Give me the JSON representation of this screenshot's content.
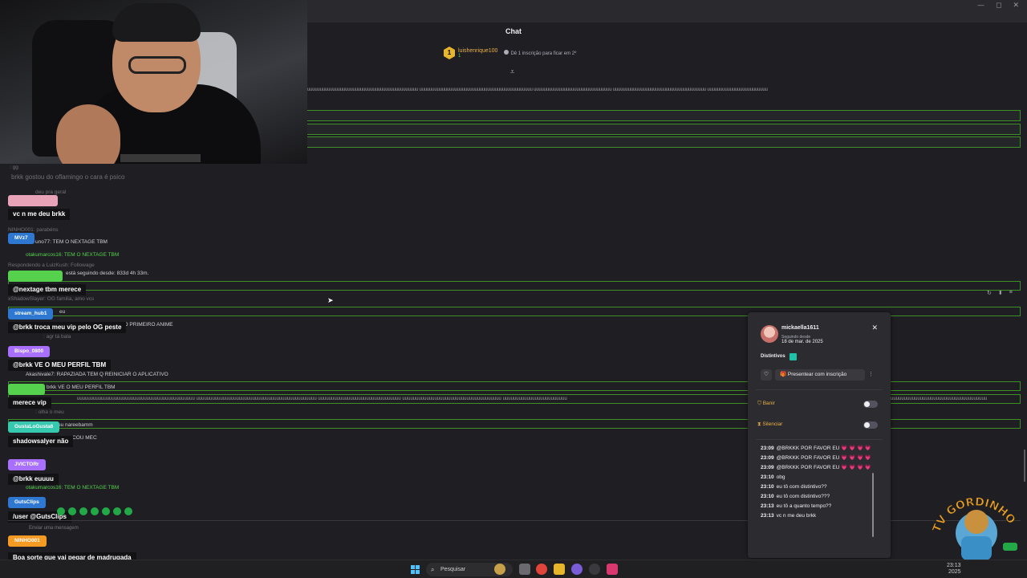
{
  "window": {
    "chat_title": "Chat",
    "minimize": "—",
    "maximize": "◻",
    "close": "✕"
  },
  "hype_train": {
    "rank": "1",
    "username": "luishenrique100",
    "count": "1",
    "gift_text": "Dê 1 inscrição para ficar em 2º"
  },
  "spam_text": "uuuuuuuuuuuuuuuuuuuuuuuuuuuuuuuuuuuuuuuuuuuu uuuuuuuuuuuuuuuuuuuuuuuuuuuuuuuuuuuuuuuuuuuuu uuuuuuuuuuuuuuuuuuuuuuuuuuuuuuu uuuuuuuuuuuuuuuuuuuuuuuuuuuuuuuuuuuuu uuuuuuuuuuuuuuuuuuuuuuuu",
  "background_chat": [
    {
      "text": ": gg"
    },
    {
      "text": "brkk gostou do oflamingo o cara é psico"
    },
    {
      "text": "deu pra geral"
    },
    {
      "text": "NINHO001: parabéns"
    },
    {
      "text": "uno77: TEM O NEXTAGE TBM"
    },
    {
      "text": "otakumarcos16: TEM O NEXTAGE TBM"
    },
    {
      "text": "Respondendo a LuizKush: Followage"
    },
    {
      "text": "está seguindo desde: 833d 4h 33m."
    },
    {
      "text": "xShadowSlayer: OG familia, amo vcs"
    },
    {
      "text": "eu"
    },
    {
      "text": "BRKK TO AO PODER TER O PRIMEIRO ANIME"
    },
    {
      "text": ": agr tá bala"
    },
    {
      "text": "Akashivale7: RAPAZIADA TEM Q REINICIAR O APLICATIVO"
    },
    {
      "text": "brkk VE O MEU PERFIL TBM"
    },
    {
      "text": ": olha o meu"
    },
    {
      "text": "uu nareebamm"
    },
    {
      "text": "COU MEC"
    },
    {
      "text": "otakumarcos16: TEM O NEXTAGE TBM"
    }
  ],
  "overlay_messages": [
    {
      "user": "",
      "color": "#e9a3b8",
      "text": "vc n me deu brkk"
    },
    {
      "user": "MVz7",
      "color": "#2e78d2",
      "text": ""
    },
    {
      "user": "",
      "color": "#56d14d",
      "text": "@nextage tbm merece"
    },
    {
      "user": "stream_hub1",
      "color": "#2e78d2",
      "text": "@brkk troca meu vip pelo OG peste"
    },
    {
      "user": "Bispo_0800",
      "color": "#a970ff",
      "text": "@brkk VE O MEU PERFIL TBM"
    },
    {
      "user": "",
      "color": "#56d14d",
      "text": "merece vip"
    },
    {
      "user": "GustaLoGusta6",
      "color": "#36c9b0",
      "text": "shadowsalyer não"
    },
    {
      "user": "JVICTORr",
      "color": "#a970ff",
      "text": "@brkk euuuu"
    },
    {
      "user": "GutsClips",
      "color": "#2e78d2",
      "text": "/user @GutsClips"
    },
    {
      "user": "NINHO001",
      "color": "#f59a23",
      "text": "Boa sorte que vai pegar de madrugada"
    }
  ],
  "chat_input_placeholder": "Enviar uma mensagem",
  "user_card": {
    "username": "mickaella1611",
    "since_label": "Seguindo desde",
    "since_date": "18 de mar. de 2025",
    "badges_label": "Distintivos",
    "gift_label": "Presentear com inscrição",
    "ban_label": "Banir",
    "timeout_label": "Silenciar",
    "close": "✕",
    "history": [
      {
        "time": "23:09",
        "text": "@BRKKK POR FAVOR EU",
        "hearts": "💗 💗 💗 💗"
      },
      {
        "time": "23:09",
        "text": "@BRKKK POR FAVOR EU",
        "hearts": "💗 💗 💗 💗"
      },
      {
        "time": "23:09",
        "text": "@BRKKK POR FAVOR EU",
        "hearts": "💗 💗 💗 💗"
      },
      {
        "time": "23:10",
        "text": "obg",
        "hearts": ""
      },
      {
        "time": "23:10",
        "text": "eu tô com distintivo??",
        "hearts": ""
      },
      {
        "time": "23:10",
        "text": "eu tô com distintivo???",
        "hearts": ""
      },
      {
        "time": "23:13",
        "text": "eu tô a quanto tempo??",
        "hearts": ""
      },
      {
        "time": "23:13",
        "text": "vc n me deu brkk",
        "hearts": ""
      }
    ]
  },
  "logo_text": "TV GORDINHO",
  "taskbar": {
    "search_placeholder": "Pesquisar",
    "time": "23:13",
    "date": "2025"
  },
  "colors": {
    "accent_green": "#3e8f2a",
    "highlight_yellow": "#eab04a",
    "twitch_purple": "#a970ff"
  }
}
